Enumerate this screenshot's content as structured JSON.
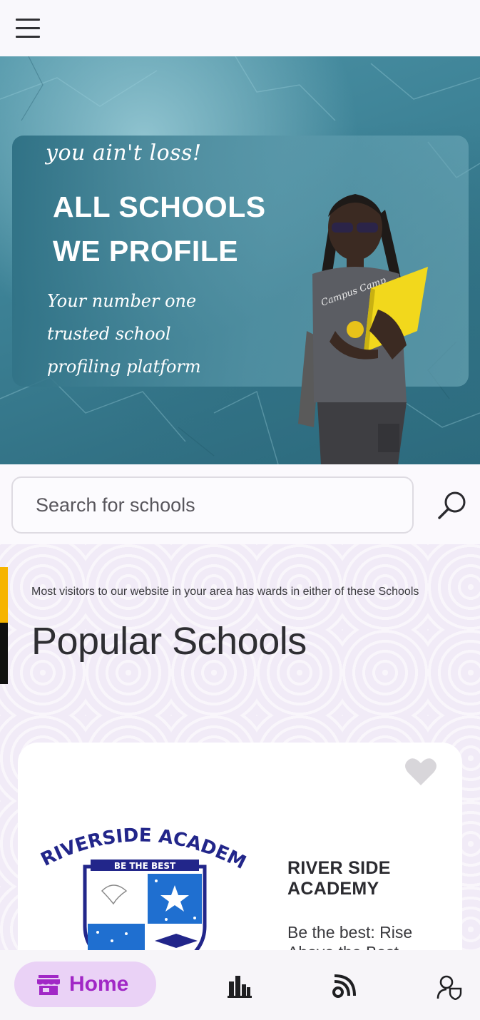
{
  "header": {
    "menu_icon": "hamburger-menu-icon"
  },
  "hero": {
    "tagline": "you ain't loss!",
    "headline_line1": "ALL SCHOOLS",
    "headline_line2": "WE PROFILE",
    "subtag_line1": "Your number one",
    "subtag_line2": "trusted school",
    "subtag_line3": "profiling platform",
    "shirt_text": "Campus Camp Reloaded"
  },
  "search": {
    "placeholder": "Search for schools",
    "value": "",
    "icon": "search-icon"
  },
  "popular": {
    "note": "Most visitors to our website in your area has wards in either of these Schools",
    "title": "Popular Schools",
    "schools": [
      {
        "name": "RIVER SIDE ACADEMY",
        "motto": "Be the best: Rise Above the Best",
        "logo_text": "RIVERSIDE ACADEMY",
        "logo_banner": "BE THE BEST"
      }
    ]
  },
  "bottom_nav": {
    "home_label": "Home",
    "items": [
      "home-icon",
      "leaderboard-icon",
      "blog-feed-icon",
      "account-security-icon"
    ]
  },
  "colors": {
    "accent": "#a128c6",
    "accent_bg": "#ead2f6",
    "hero_teal": "#3d8296",
    "section_bg": "#f1ebf7"
  }
}
